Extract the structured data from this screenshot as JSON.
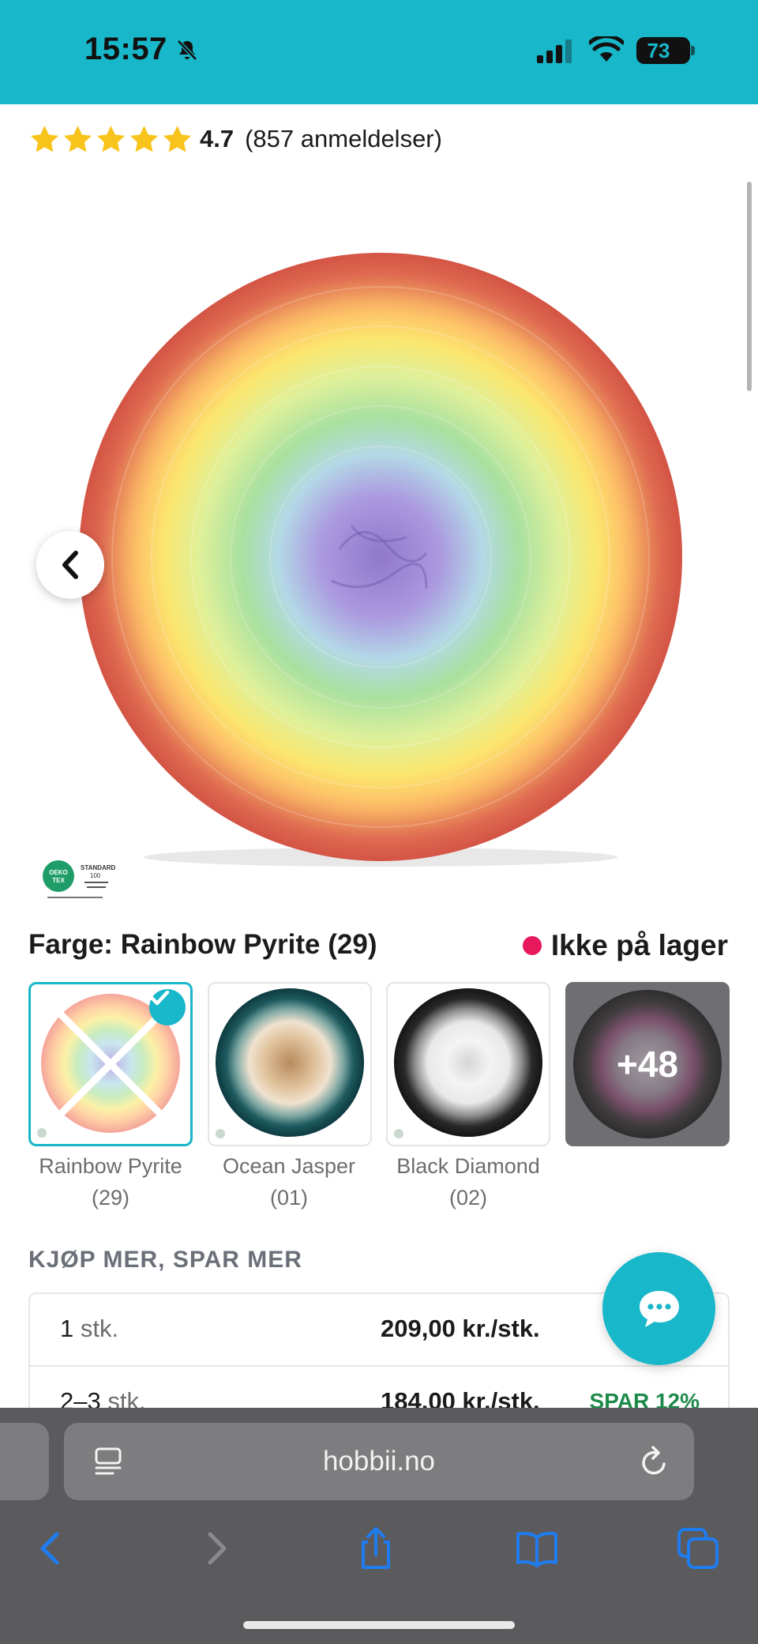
{
  "status": {
    "time": "15:57",
    "battery": "73"
  },
  "rating": {
    "value": "4.7",
    "count": "(857 anmeldelser)",
    "stars": 5
  },
  "hero": {
    "certification": "OEKO TEX STANDARD 100"
  },
  "color": {
    "heading": "Farge: Rainbow Pyrite (29)",
    "stock": "Ikke på lager"
  },
  "swatches": [
    {
      "name": "Rainbow Pyrite",
      "code": "(29)",
      "selected": true
    },
    {
      "name": "Ocean Jasper",
      "code": "(01)",
      "selected": false
    },
    {
      "name": "Black Diamond",
      "code": "(02)",
      "selected": false
    }
  ],
  "more_swatches": "+48",
  "buy_more": {
    "title": "KJØP MER, SPAR MER",
    "rows": [
      {
        "qty": "1",
        "unit": "stk.",
        "price": "209,00 kr./stk.",
        "save": "0"
      },
      {
        "qty": "2–3",
        "unit": "stk.",
        "price": "184,00 kr./stk.",
        "save": "SPAR 12%"
      }
    ]
  },
  "browser": {
    "url": "hobbii.no"
  },
  "colors": {
    "accent": "#18b7c9",
    "out_of_stock": "#e8185d",
    "save_green": "#1e8a4a"
  }
}
